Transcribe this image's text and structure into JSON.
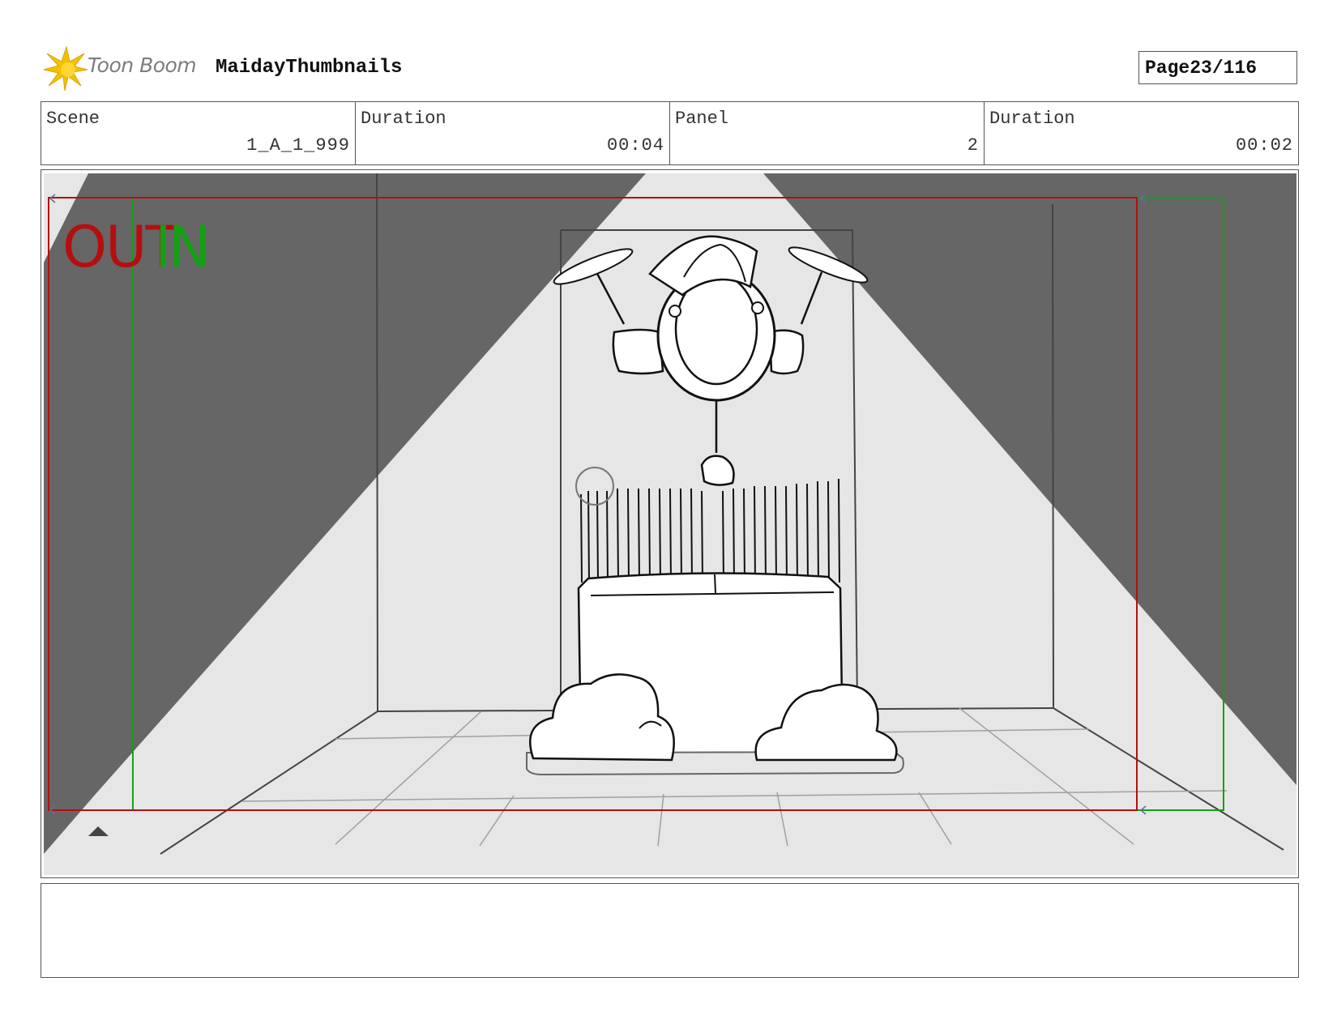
{
  "header": {
    "logo_text": "Toon Boom",
    "project_title": "MaidayThumbnails",
    "page_label": "Page",
    "page_number": "23/116"
  },
  "info": [
    {
      "label": "Scene",
      "value": "1_A_1_999"
    },
    {
      "label": "Duration",
      "value": "00:04"
    },
    {
      "label": "Panel",
      "value": "2"
    },
    {
      "label": "Duration",
      "value": "00:02"
    }
  ],
  "panel": {
    "out_label": "OUT",
    "in_label": "IN"
  },
  "notes": {
    "text": ""
  },
  "colors": {
    "shadow": "#666666",
    "light": "#e6e6e6",
    "out_frame": "#b40f0f",
    "in_frame": "#14a014",
    "logo_star": "#f2c200"
  }
}
